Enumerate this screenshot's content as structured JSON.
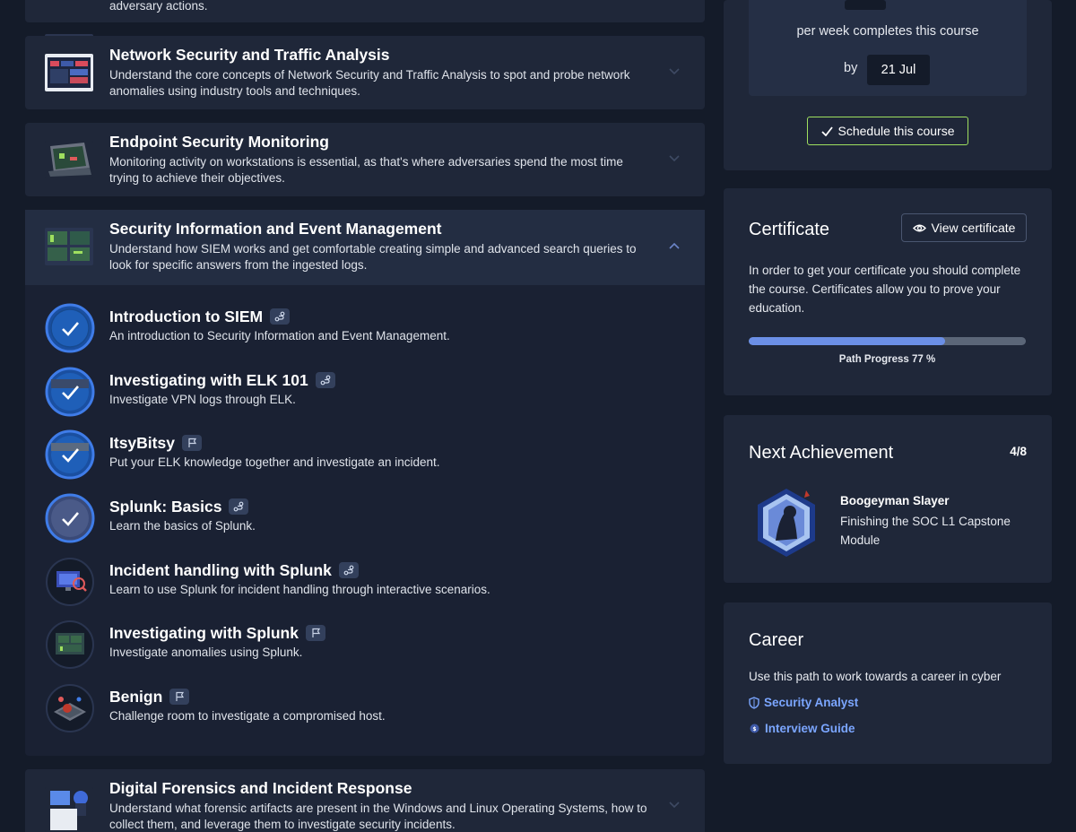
{
  "modules": [
    {
      "title": "",
      "description": "adversary actions.",
      "expanded": false
    },
    {
      "title": "Network Security and Traffic Analysis",
      "description": "Understand the core concepts of Network Security and Traffic Analysis to spot and probe network anomalies using industry tools and techniques.",
      "expanded": false
    },
    {
      "title": "Endpoint Security Monitoring",
      "description": "Monitoring activity on workstations is essential, as that's where adversaries spend the most time trying to achieve their objectives.",
      "expanded": false
    },
    {
      "title": "Security Information and Event Management",
      "description": "Understand how SIEM works and get comfortable creating simple and advanced search queries to look for specific answers from the ingested logs.",
      "expanded": true
    },
    {
      "title": "Digital Forensics and Incident Response",
      "description": "Understand what forensic artifacts are present in the Windows and Linux Operating Systems, how to collect them, and leverage them to investigate security incidents.",
      "expanded": false
    }
  ],
  "rooms": [
    {
      "title": "Introduction to SIEM",
      "description": "An introduction to Security Information and Event Management.",
      "type_icon": "walkthrough-icon",
      "completed": true
    },
    {
      "title": "Investigating with ELK 101",
      "description": "Investigate VPN logs through ELK.",
      "type_icon": "walkthrough-icon",
      "completed": true
    },
    {
      "title": "ItsyBitsy",
      "description": "Put your ELK knowledge together and investigate an incident.",
      "type_icon": "flag-icon",
      "completed": true
    },
    {
      "title": "Splunk: Basics",
      "description": "Learn the basics of Splunk.",
      "type_icon": "walkthrough-icon",
      "completed": true
    },
    {
      "title": "Incident handling with Splunk",
      "description": "Learn to use Splunk for incident handling through interactive scenarios.",
      "type_icon": "walkthrough-icon",
      "completed": false
    },
    {
      "title": "Investigating with Splunk",
      "description": "Investigate anomalies using Splunk.",
      "type_icon": "flag-icon",
      "completed": false
    },
    {
      "title": "Benign",
      "description": "Challenge room to investigate a compromised host.",
      "type_icon": "flag-icon",
      "completed": false
    }
  ],
  "schedule": {
    "per_week_text": "per week completes this course",
    "by_label": "by",
    "date": "21 Jul",
    "button_label": "Schedule this course"
  },
  "certificate": {
    "title": "Certificate",
    "view_button": "View certificate",
    "text": "In order to get your certificate you should complete the course. Certificates allow you to prove your education.",
    "progress_label": "Path Progress 77 %",
    "progress": 0.71
  },
  "achievement": {
    "title": "Next Achievement",
    "count": "4/8",
    "name": "Boogeyman Slayer",
    "description": "Finishing the SOC L1 Capstone Module"
  },
  "career": {
    "title": "Career",
    "text": "Use this path to work towards a career in cyber",
    "links": [
      "Security Analyst",
      "Interview Guide"
    ]
  },
  "colors": {
    "background": "#141b29",
    "card": "#1f2739",
    "accent_green": "#9fdf5f",
    "accent_blue": "#6b8fe6",
    "link_blue": "#7ba6ff"
  }
}
